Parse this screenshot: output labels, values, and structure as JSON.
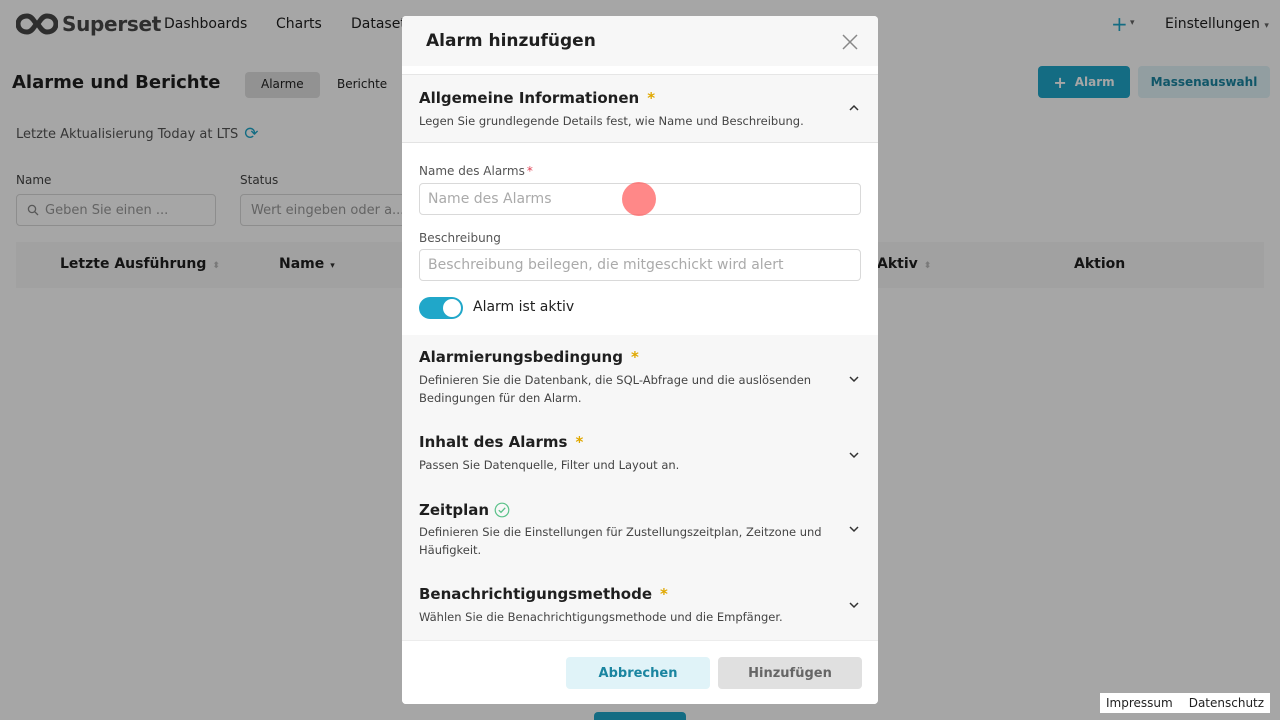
{
  "app": {
    "logo_text": "Superset",
    "nav": [
      "Dashboards",
      "Charts",
      "Dataset"
    ],
    "settings_label": "Einstellungen",
    "plus_icon": "plus-icon"
  },
  "page": {
    "title": "Alarme und Berichte",
    "tabs": [
      "Alarme",
      "Berichte"
    ],
    "alarm_button": "Alarm",
    "mass_select_button": "Massenauswahl",
    "last_update": "Letzte Aktualisierung Today at LTS",
    "filters": {
      "name_label": "Name",
      "name_placeholder": "Geben Sie einen ...",
      "status_label": "Status",
      "status_placeholder": "Wert eingeben oder a..."
    },
    "table_headers": [
      "Letzte Ausführung",
      "Name",
      "Aktiv",
      "Aktion"
    ],
    "footer_links": [
      "Impressum",
      "Datenschutz"
    ]
  },
  "modal": {
    "title": "Alarm hinzufügen",
    "sections": [
      {
        "title": "Allgemeine Informationen",
        "required": "*",
        "description": "Legen Sie grundlegende Details fest, wie Name und Beschreibung."
      },
      {
        "title": "Alarmierungsbedingung",
        "required": "*",
        "description": "Definieren Sie die Datenbank, die SQL-Abfrage und die auslösenden Bedingungen für den Alarm."
      },
      {
        "title": "Inhalt des Alarms",
        "required": "*",
        "description": "Passen Sie Datenquelle, Filter und Layout an."
      },
      {
        "title": "Zeitplan",
        "required": "",
        "description": "Definieren Sie die Einstellungen für Zustellungszeitplan, Zeitzone und Häufigkeit."
      },
      {
        "title": "Benachrichtigungsmethode",
        "required": "*",
        "description": "Wählen Sie die Benachrichtigungsmethode und die Empfänger."
      }
    ],
    "fields": {
      "name_label": "Name des Alarms",
      "name_required": "*",
      "name_placeholder": "Name des Alarms",
      "name_value": "",
      "description_label": "Beschreibung",
      "description_placeholder": "Beschreibung beilegen, die mitgeschickt wird alert",
      "description_value": "",
      "active_label": "Alarm ist aktiv",
      "active": true
    },
    "cancel_button": "Abbrechen",
    "add_button": "Hinzufügen"
  },
  "colors": {
    "accent": "#20a7c9",
    "required": "#e0a800",
    "success": "#5ac189"
  }
}
